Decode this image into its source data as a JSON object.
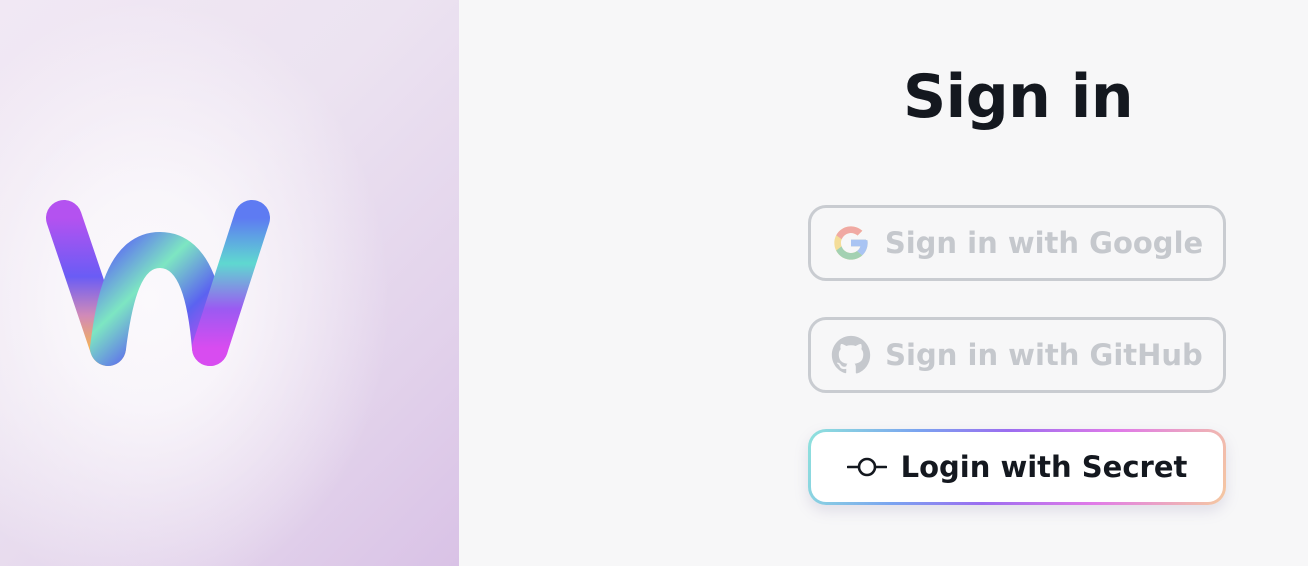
{
  "auth": {
    "title": "Sign in",
    "buttons": {
      "google": {
        "label": "Sign in with Google",
        "icon": "google-icon",
        "enabled": false
      },
      "github": {
        "label": "Sign in with GitHub",
        "icon": "github-icon",
        "enabled": false
      },
      "secret": {
        "label": "Login with Secret",
        "icon": "commit-key-icon",
        "enabled": true
      }
    }
  },
  "brand": {
    "logo": "w-logo",
    "colors": {
      "title_text": "#14181f",
      "disabled_border": "#c9ccd1",
      "disabled_text": "#c5c8cd",
      "gradient": [
        "#8fe3dc",
        "#7aa3f0",
        "#9b6df0",
        "#e07ae8",
        "#f5c9a0"
      ]
    }
  }
}
